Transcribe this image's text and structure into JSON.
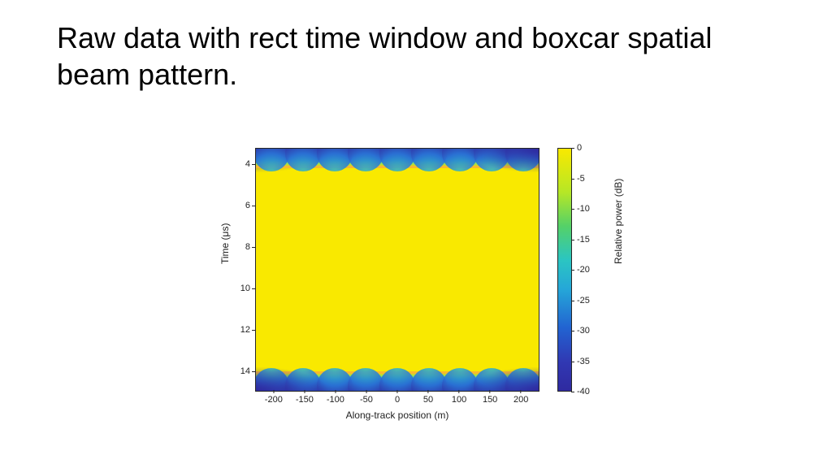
{
  "title": "Raw data with rect time window and boxcar spatial beam pattern.",
  "chart_data": {
    "type": "heatmap",
    "title": "",
    "xlabel": "Along-track position (m)",
    "ylabel": "Time (μs)",
    "xlim": [
      -230,
      230
    ],
    "ylim": [
      3.2,
      15
    ],
    "y_reversed": true,
    "xticks": [
      -200,
      -150,
      -100,
      -50,
      0,
      50,
      100,
      150,
      200
    ],
    "yticks": [
      4,
      6,
      8,
      10,
      12,
      14
    ],
    "colorbar": {
      "label": "Relative power (dB)",
      "range": [
        -40,
        0
      ],
      "ticks": [
        0,
        -5,
        -10,
        -15,
        -20,
        -25,
        -30,
        -35,
        -40
      ],
      "colormap": "parula"
    },
    "description": "Uniform high power (~0 dB, yellow) across nearly the full time range 4.2–14.4 μs and full along-track span. Narrow fringes (~0.7 μs) at the top (3.5–4.2 μs) and bottom (14.4–15 μs) fall to low power (to -40 dB, blue) at the outer edges, with periodic sidelobe lobes along track and deepest nulls toward the corners."
  }
}
